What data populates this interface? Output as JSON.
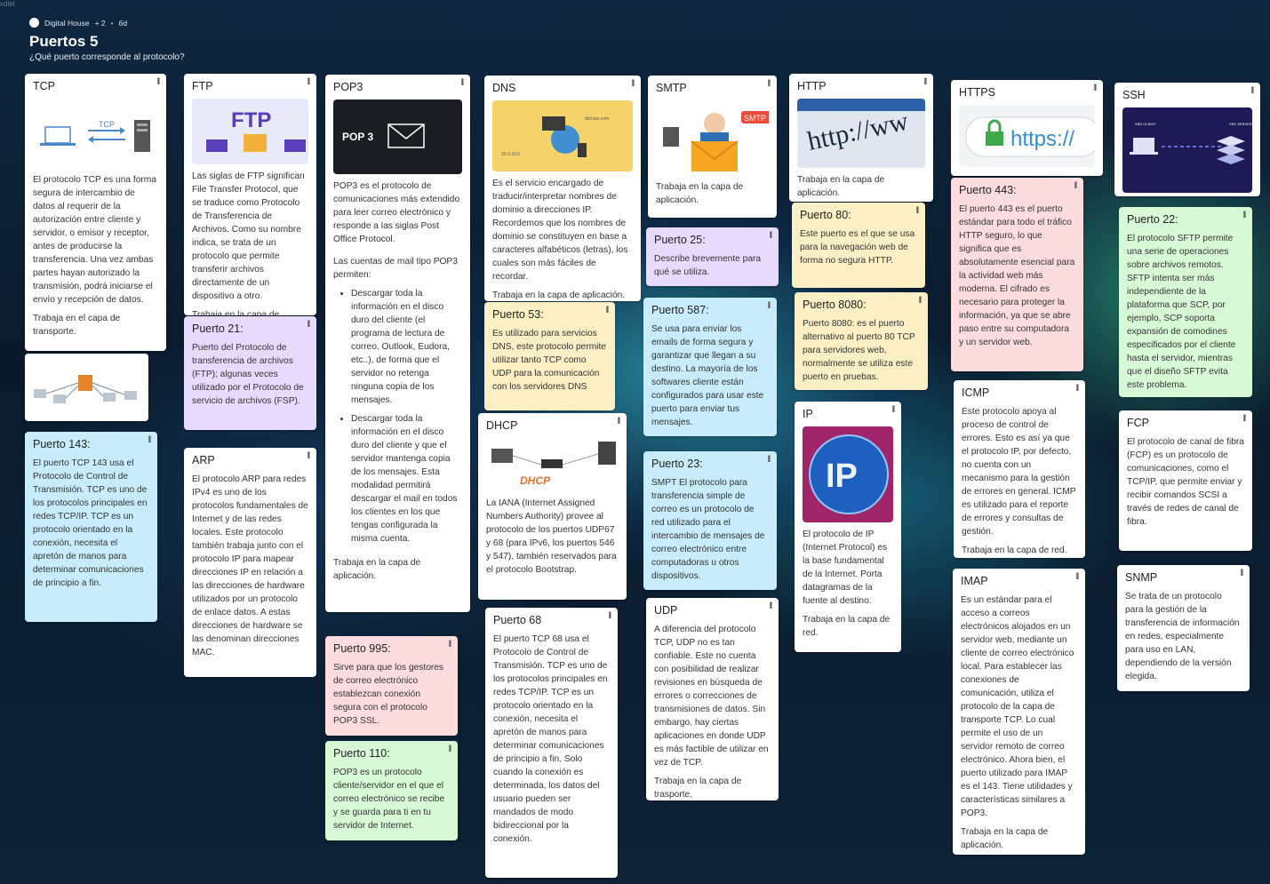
{
  "corner": "xdiet",
  "header": {
    "workspace": "Digital House",
    "collaborators": "+ 2",
    "age": "6d",
    "title": "Puertos 5",
    "subtitle": "¿Qué puerto corresponde al protocolo?"
  },
  "cards": {
    "tcp": {
      "title": "TCP",
      "text": "El protocolo TCP es una forma segura de intercambio de datos al requerir de la autorización entre cliente y servidor, o emisor y receptor, antes de producirse la transferencia. Una vez ambas partes hayan autorizado la transmisión, podrá iniciarse el envío y recepción de datos.",
      "text2": "Trabaja en el capa de transporte.",
      "img_label": "TCP"
    },
    "puerto143": {
      "title": "Puerto 143:",
      "text": "El puerto TCP 143 usa el Protocolo de Control de Transmisión. TCP es uno de los protocolos principales en redes TCP/IP. TCP es un protocolo orientado en la conexión, necesita el apretón de manos para determinar comunicaciones de principio a fin."
    },
    "ftp": {
      "title": "FTP",
      "img_label": "FTP",
      "text": "Las siglas de FTP significan File Transfer Protocol, que se traduce como Protocolo de Transferencia de Archivos. Como su nombre indica, se trata de un protocolo que permite transferir archivos directamente de un dispositivo a otro.",
      "text2": "Trabaja en la capa de"
    },
    "puerto21": {
      "title": "Puerto 21:",
      "text": "Puerto del Protocolo de transferencia de archivos (FTP); algunas veces utilizado por el Protocolo de servicio de archivos (FSP)."
    },
    "arp": {
      "title": "ARP",
      "text": "El protocolo ARP para redes IPv4 es uno de los protocolos fundamentales de Internet y de las redes locales. Este protocolo también trabaja junto con el protocolo IP para mapear direcciones IP en relación a las direcciones de hardware utilizados por un protocolo de enlace datos. A estas direcciones de hardware se las denominan direcciones MAC."
    },
    "pop3": {
      "title": "POP3",
      "img_label": "POP 3",
      "text": "POP3 es el protocolo de comunicaciones más extendido para leer correo electrónico y responde a las siglas Post Office Protocol.",
      "text2": "Las cuentas de mail tipo POP3 permiten:",
      "li1": "Descargar toda la información en el disco duro del cliente (el programa de lectura de correo, Outlook, Eudora, etc..), de forma que el servidor no retenga ninguna copia de los mensajes.",
      "li2": "Descargar toda la información en el disco duro del cliente y que el servidor mantenga copia de los mensajes. Esta modalidad permitirá descargar el mail en todos los clientes en los que tengas configurada la misma cuenta.",
      "text3": "Trabaja en la capa de aplicación."
    },
    "puerto995": {
      "title": "Puerto 995:",
      "text": "Sirve para que los gestores de correo electrónico establezcan conexión segura con el protocolo POP3 SSL."
    },
    "puerto110": {
      "title": "Puerto 110:",
      "text": "POP3 es un protocolo cliente/servidor en el que el correo electrónico se recibe y se guarda para ti en tu servidor de Internet."
    },
    "dns": {
      "title": "DNS",
      "text": "Es el servicio encargado de traducir/interpretar nombres de dominio a direcciones IP. Recordemos que los nombres de dominio se constituyen en base a caracteres alfabéticos (letras), los cuales son más fáciles de recordar.",
      "text2": "Trabaja en la capa de aplicación.",
      "img_domain": "domain.com",
      "img_ip": "29.0.10.0"
    },
    "puerto53": {
      "title": "Puerto 53:",
      "text": "Es utilizado para servicios DNS, este protocolo permite utilizar tanto TCP como UDP para la comunicación con los servidores DNS"
    },
    "dhcp": {
      "title": "DHCP",
      "img_label": "DHCP",
      "text": "La IANA (Internet Assigned Numbers Authority) provee al protocolo de los puertos UDP67 y 68 (para IPv6, los puertos 546 y 547), también reservados para el protocolo Bootstrap."
    },
    "puerto68": {
      "title": "Puerto 68",
      "text": "El puerto TCP 68 usa el Protocolo de Control de Transmisión. TCP es uno de los protocolos principales en redes TCP/IP. TCP es un protocolo orientado en la conexión, necesita el apretón de manos para determinar comunicaciones de principio a fin. Solo cuando la conexión es determinada, los datos del usuario pueden ser mandados de modo bidireccional por la conexión."
    },
    "smtp": {
      "title": "SMTP",
      "img_label": "SMTP",
      "text": "Trabaja en la capa de aplicación."
    },
    "puerto25": {
      "title": "Puerto 25:",
      "text": "Describe brevemente para qué se utiliza."
    },
    "puerto587": {
      "title": "Puerto 587:",
      "text": "Se usa para enviar los emails de forma segura y garantizar que llegan a su destino. La mayoría de los softwares cliente están configurados para usar este puerto para enviar tus mensajes."
    },
    "puerto23": {
      "title": "Puerto 23:",
      "text": "SMPT El protocolo para transferencia simple de correo es un protocolo de red utilizado para el intercambio de mensajes de correo electrónico entre computadoras u otros dispositivos."
    },
    "udp": {
      "title": "UDP",
      "text": "A diferencia del protocolo TCP, UDP no es tan confiable. Este no cuenta con posibilidad de realizar revisiones en búsqueda de errores o correcciones de transmisiones de datos. Sin embargo, hay ciertas aplicaciones en donde UDP es más factible de utilizar en vez de TCP.",
      "text2": "Trabaja en la capa de trasporte."
    },
    "http": {
      "title": "HTTP",
      "img_label": "http://ww",
      "text": "Trabaja en la capa de aplicación."
    },
    "puerto80": {
      "title": "Puerto 80:",
      "text": "Este puerto es el que se usa para la navegación web de forma no segura HTTP."
    },
    "puerto8080": {
      "title": "Puerto 8080:",
      "text": "Puerto 8080: es el puerto alternativo al puerto 80 TCP para servidores web, normalmente se utiliza este puerto en pruebas."
    },
    "ip": {
      "title": "IP",
      "img_label": "IP",
      "text": "El protocolo de IP (Internet Protocol) es la base fundamental de la Internet. Porta datagramas de la fuente al destino.",
      "text2": "Trabaja en la capa de red."
    },
    "https": {
      "title": "HTTPS",
      "img_label": "https://"
    },
    "puerto443": {
      "title": "Puerto 443:",
      "text": "El puerto 443 es el puerto estándar para todo el tráfico HTTP seguro, lo que significa que es absolutamente esencial para la actividad web más moderna. El cifrado es necesario para proteger la información, ya que se abre paso entre su computadora y un servidor web."
    },
    "icmp": {
      "title": "ICMP",
      "text": "Este protocolo apoya al proceso de control de errores. Esto es así ya que el protocolo IP, por defecto, no cuenta con un mecanismo para la gestión de errores en general. ICMP es utilizado para el reporte de errores y consultas de gestión.",
      "text2": "Trabaja en la capa de red."
    },
    "imap": {
      "title": "IMAP",
      "text": "Es un estándar para el acceso a correos electrónicos alojados en un servidor web, mediante un cliente de correo electrónico local. Para establecer las conexiones de comunicación, utiliza el protocolo de la capa de transporte TCP. Lo cual permite el uso de un servidor remoto de correo electrónico. Ahora bien, el puerto utilizado para IMAP es el 143. Tiene utilidades y características similares a POP3.",
      "text2": "Trabaja en la capa de aplicación."
    },
    "ssh": {
      "title": "SSH",
      "img_client": "SSH CLIENT",
      "img_server": "SSH SERVER"
    },
    "puerto22": {
      "title": "Puerto 22:",
      "text": "El protocolo SFTP permite una serie de operaciones sobre archivos remotos. SFTP intenta ser más independiente de la plataforma que SCP, por ejemplo, SCP soporta expansión de comodines especificados por el cliente hasta el servidor, mientras que el diseño SFTP evita este problema."
    },
    "fcp": {
      "title": "FCP",
      "text": "El protocolo de canal de fibra (FCP) es un protocolo de comunicaciones, como el TCP/IP, que permite enviar y recibir comandos SCSI a través de redes de canal de fibra."
    },
    "snmp": {
      "title": "SNMP",
      "text": "Se trata de un protocolo para la gestión de la transferencia de información en redes, especialmente para uso en LAN, dependiendo de la versión elegida."
    }
  },
  "colors": {
    "blue": "#c7ecfb",
    "purple": "#e7dafd",
    "yellow": "#fcefc4",
    "pink": "#fcdcdc",
    "green": "#d8f9d6",
    "ftp_purple": "#5a3db8",
    "dhcp_orange": "#e8702a"
  }
}
